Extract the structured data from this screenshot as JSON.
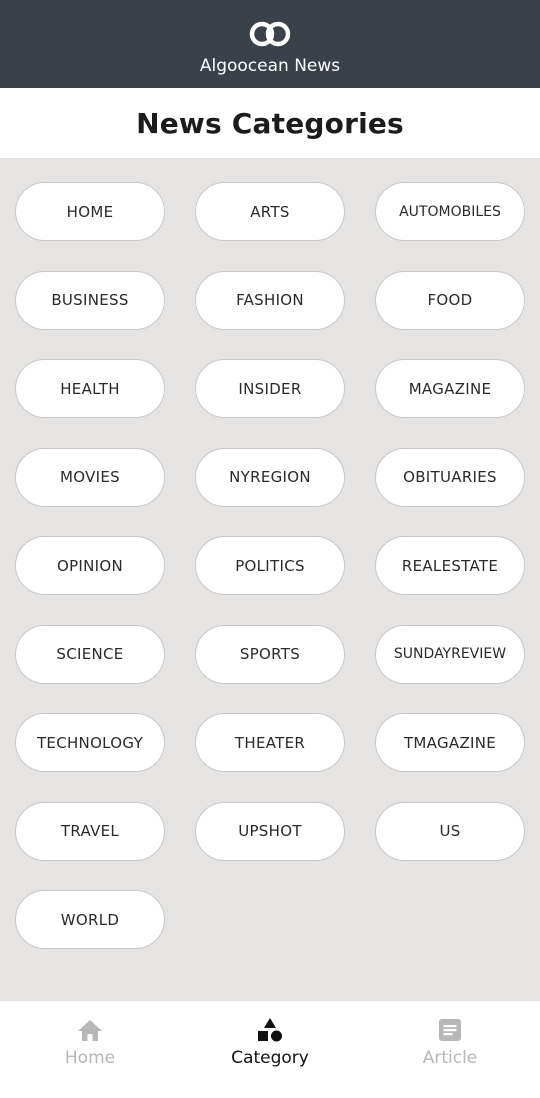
{
  "header": {
    "logo_icon": "two-linked-rings-logo",
    "app_title": "Algoocean News"
  },
  "page": {
    "title": "News Categories"
  },
  "categories": [
    "HOME",
    "ARTS",
    "AUTOMOBILES",
    "BUSINESS",
    "FASHION",
    "FOOD",
    "HEALTH",
    "INSIDER",
    "MAGAZINE",
    "MOVIES",
    "NYREGION",
    "OBITUARIES",
    "OPINION",
    "POLITICS",
    "REALESTATE",
    "SCIENCE",
    "SPORTS",
    "SUNDAYREVIEW",
    "TECHNOLOGY",
    "THEATER",
    "TMAGAZINE",
    "TRAVEL",
    "UPSHOT",
    "US",
    "WORLD"
  ],
  "bottom_nav": {
    "items": [
      {
        "label": "Home",
        "icon": "home-icon",
        "active": false
      },
      {
        "label": "Category",
        "icon": "shapes-icon",
        "active": true
      },
      {
        "label": "Article",
        "icon": "article-icon",
        "active": false
      }
    ]
  },
  "colors": {
    "header_bg": "#3b4149",
    "content_bg": "#e5e4e2",
    "chip_bg": "#ffffff",
    "chip_border": "#c8c8c8",
    "nav_active": "#111111",
    "nav_inactive": "#b7b7b7"
  }
}
